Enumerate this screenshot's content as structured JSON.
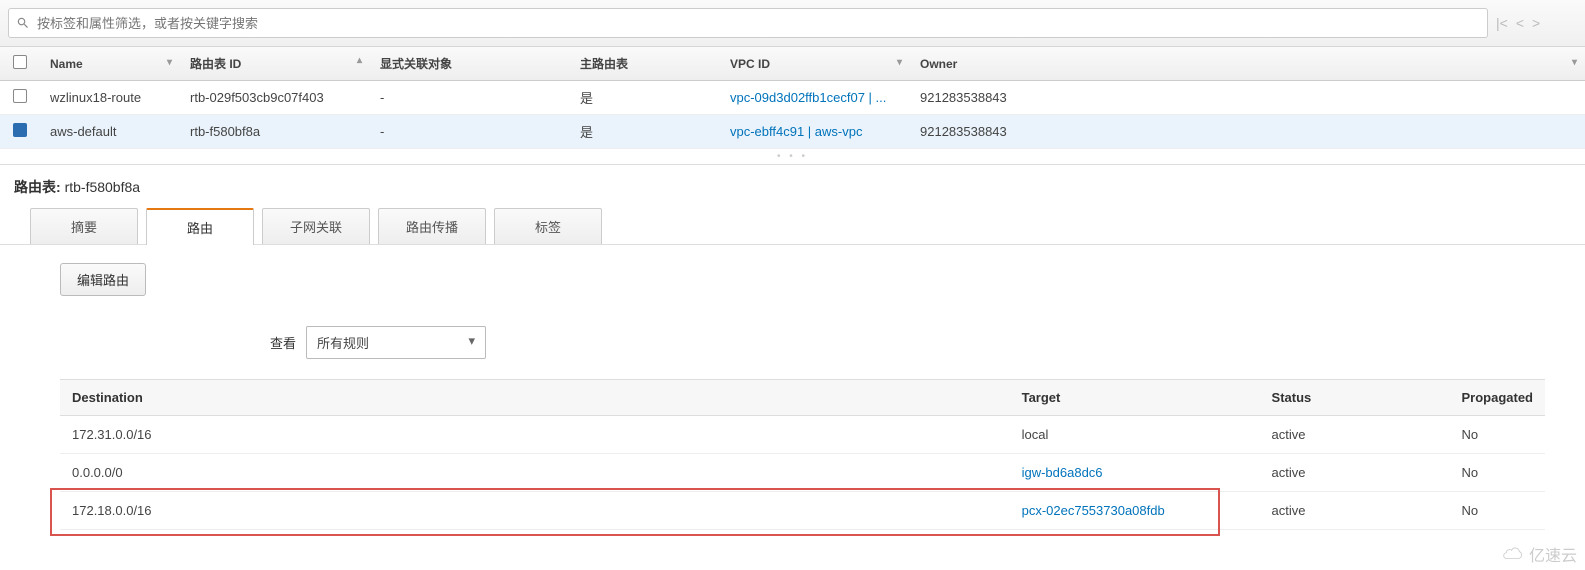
{
  "search": {
    "placeholder": "按标签和属性筛选，或者按关键字搜索"
  },
  "columns": {
    "check": "",
    "name": "Name",
    "rtb_id": "路由表 ID",
    "explicit": "显式关联对象",
    "main": "主路由表",
    "vpc_id": "VPC ID",
    "owner": "Owner"
  },
  "rows": [
    {
      "selected": false,
      "name": "wzlinux18-route",
      "rtb_id": "rtb-029f503cb9c07f403",
      "explicit": "-",
      "main": "是",
      "vpc_id": "vpc-09d3d02ffb1cecf07 | ...",
      "owner": "921283538843"
    },
    {
      "selected": true,
      "name": "aws-default",
      "rtb_id": "rtb-f580bf8a",
      "explicit": "-",
      "main": "是",
      "vpc_id": "vpc-ebff4c91 | aws-vpc",
      "owner": "921283538843"
    }
  ],
  "detail": {
    "label": "路由表:",
    "value": "rtb-f580bf8a"
  },
  "tabs": [
    "摘要",
    "路由",
    "子网关联",
    "路由传播",
    "标签"
  ],
  "active_tab": 1,
  "edit_button": "编辑路由",
  "view": {
    "label": "查看",
    "selected": "所有规则"
  },
  "route_columns": {
    "dest": "Destination",
    "target": "Target",
    "status": "Status",
    "prop": "Propagated"
  },
  "routes": [
    {
      "dest": "172.31.0.0/16",
      "target": "local",
      "target_link": false,
      "status": "active",
      "prop": "No"
    },
    {
      "dest": "0.0.0.0/0",
      "target": "igw-bd6a8dc6",
      "target_link": true,
      "status": "active",
      "prop": "No"
    },
    {
      "dest": "172.18.0.0/16",
      "target": "pcx-02ec7553730a08fdb",
      "target_link": true,
      "status": "active",
      "prop": "No"
    }
  ],
  "watermark": "亿速云"
}
